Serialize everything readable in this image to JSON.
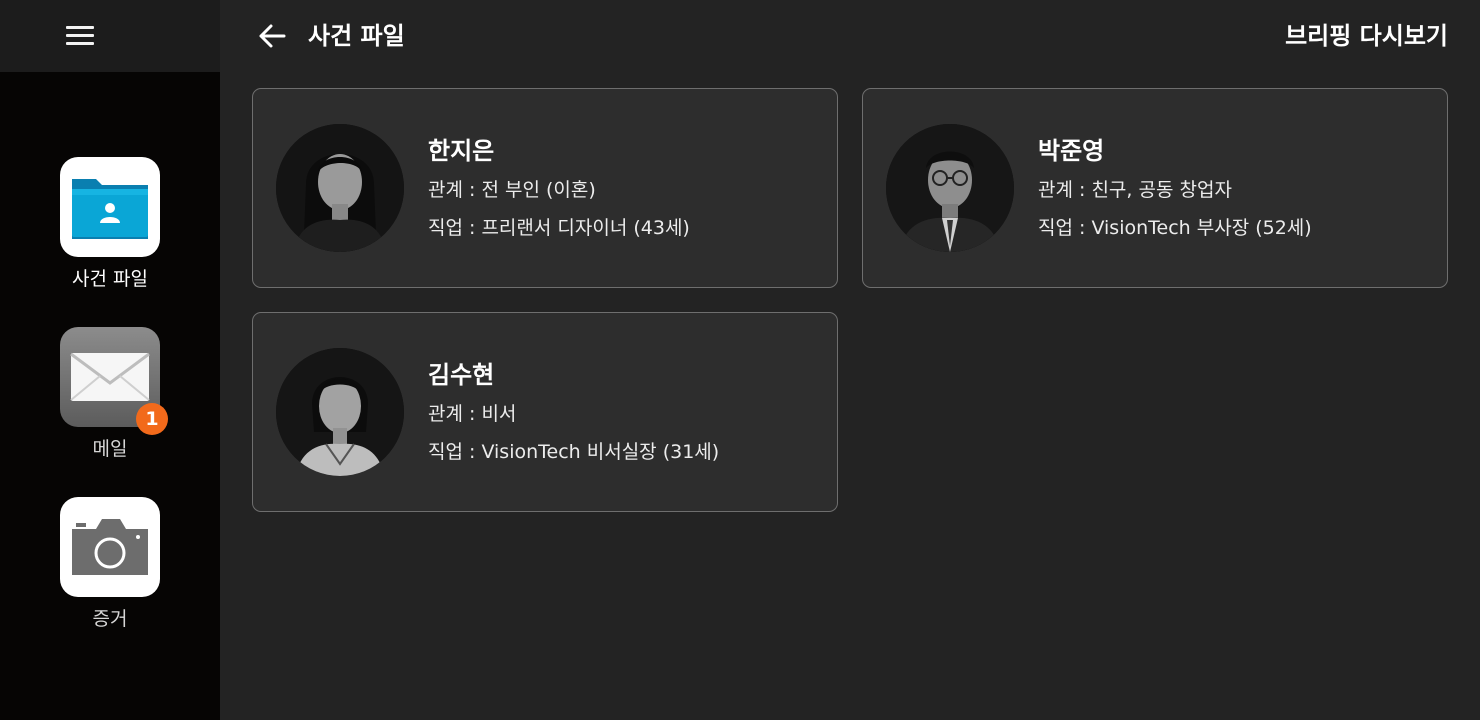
{
  "sidebar": {
    "menu_icon": "hamburger-menu-icon",
    "apps": [
      {
        "label": "사건 파일",
        "icon": "case-folder-icon",
        "active": true
      },
      {
        "label": "메일",
        "icon": "mail-envelope-icon",
        "badge": "1"
      },
      {
        "label": "증거",
        "icon": "camera-icon"
      }
    ]
  },
  "header": {
    "back_icon": "back-arrow-icon",
    "title": "사건 파일",
    "briefing_label": "브리핑 다시보기"
  },
  "people": [
    {
      "name": "한지은",
      "relation": "관계 : 전 부인 (이혼)",
      "job": "직업 : 프리랜서 디자이너 (43세)",
      "portrait": "woman-portrait"
    },
    {
      "name": "박준영",
      "relation": "관계 : 친구, 공동 창업자",
      "job": "직업 : VisionTech 부사장 (52세)",
      "portrait": "man-with-glasses-portrait"
    },
    {
      "name": "김수현",
      "relation": "관계 : 비서",
      "job": "직업 : VisionTech 비서실장 (31세)",
      "portrait": "young-woman-portrait"
    }
  ],
  "colors": {
    "background": "#232323",
    "sidebar": "#060504",
    "card": "#2d2d2d",
    "badge": "#f26a1b",
    "folder_accent": "#0aa6d6"
  }
}
